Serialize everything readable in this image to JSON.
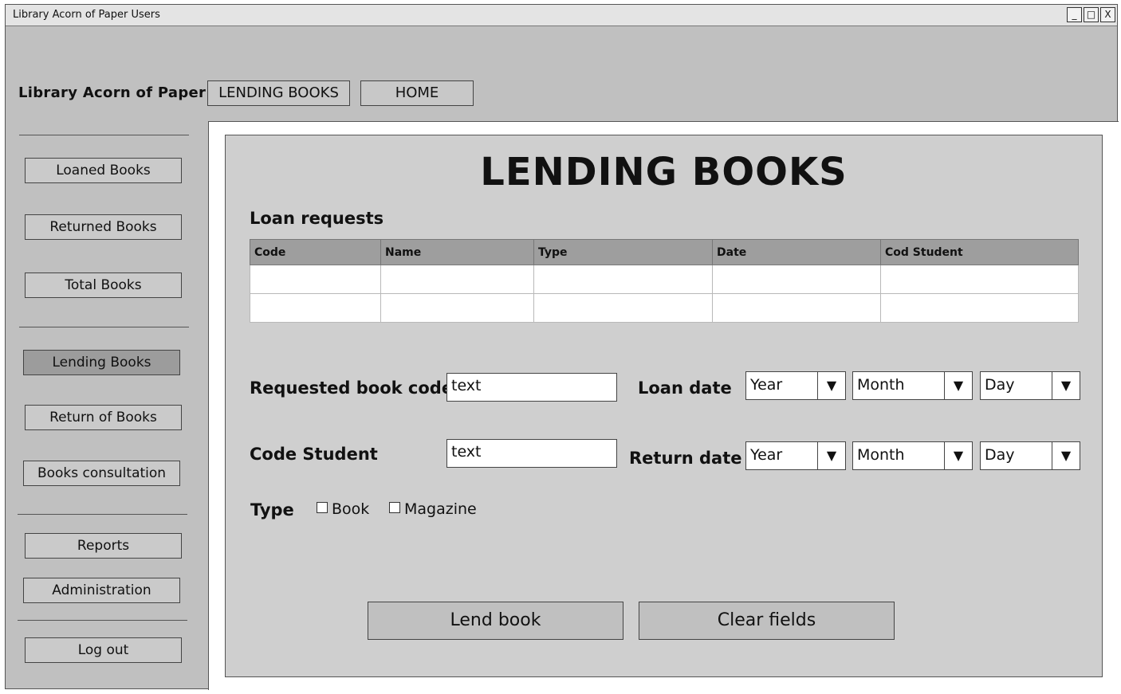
{
  "window": {
    "title": "Library Acorn of Paper Users",
    "controls": [
      "_",
      "□",
      "X"
    ]
  },
  "header": {
    "brand": "Library Acorn of Paper",
    "nav_lending": "LENDING BOOKS",
    "nav_home": "HOME"
  },
  "sidebar": {
    "loaned": "Loaned Books",
    "returned": "Returned Books",
    "total": "Total Books",
    "lending": "Lending Books",
    "return": "Return of Books",
    "consultation": "Books consultation",
    "reports": "Reports",
    "administration": "Administration",
    "logout": "Log out"
  },
  "main": {
    "heading": "LENDING BOOKS",
    "requests_label": "Loan requests",
    "table": {
      "columns": [
        "Code",
        "Name",
        "Type",
        "Date",
        "Cod Student"
      ]
    },
    "form": {
      "requested_code_label": "Requested book code",
      "requested_code_value": "text",
      "student_label": "Code Student",
      "student_value": "text",
      "loan_date_label": "Loan date",
      "return_date_label": "Return date",
      "year": "Year",
      "month": "Month",
      "day": "Day",
      "type_label": "Type",
      "book_option": "Book",
      "magazine_option": "Magazine"
    },
    "lend_button": "Lend book",
    "clear_button": "Clear fields"
  }
}
